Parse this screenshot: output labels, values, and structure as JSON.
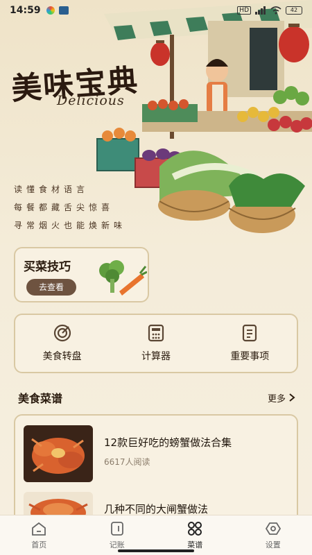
{
  "status": {
    "time": "14:59",
    "network_badge": "HD",
    "battery": "42"
  },
  "hero": {
    "title": "美味宝典",
    "subtitle": "Delicious",
    "slogans": [
      "读懂食材语言",
      "每餐都藏舌尖惊喜",
      "寻常烟火也能焕新味"
    ]
  },
  "tips_card": {
    "title": "买菜技巧",
    "button": "去查看"
  },
  "tools": [
    {
      "label": "美食转盘",
      "icon": "wheel-icon"
    },
    {
      "label": "计算器",
      "icon": "calculator-icon"
    },
    {
      "label": "重要事项",
      "icon": "notes-icon"
    }
  ],
  "recipes": {
    "section_title": "美食菜谱",
    "more_label": "更多",
    "items": [
      {
        "title": "12款巨好吃的螃蟹做法合集",
        "reads": "6617人阅读"
      },
      {
        "title": "几种不同的大闸蟹做法",
        "reads": ""
      }
    ]
  },
  "nav": {
    "items": [
      {
        "label": "首页",
        "icon": "home-icon",
        "active": false
      },
      {
        "label": "记账",
        "icon": "ledger-icon",
        "active": false
      },
      {
        "label": "菜谱",
        "icon": "recipe-grid-icon",
        "active": true
      },
      {
        "label": "设置",
        "icon": "settings-icon",
        "active": false
      }
    ]
  },
  "colors": {
    "background": "#f3ead7",
    "card_border": "#d9c8a3",
    "button_brown": "#6e5340",
    "lantern_red": "#c9332a"
  }
}
